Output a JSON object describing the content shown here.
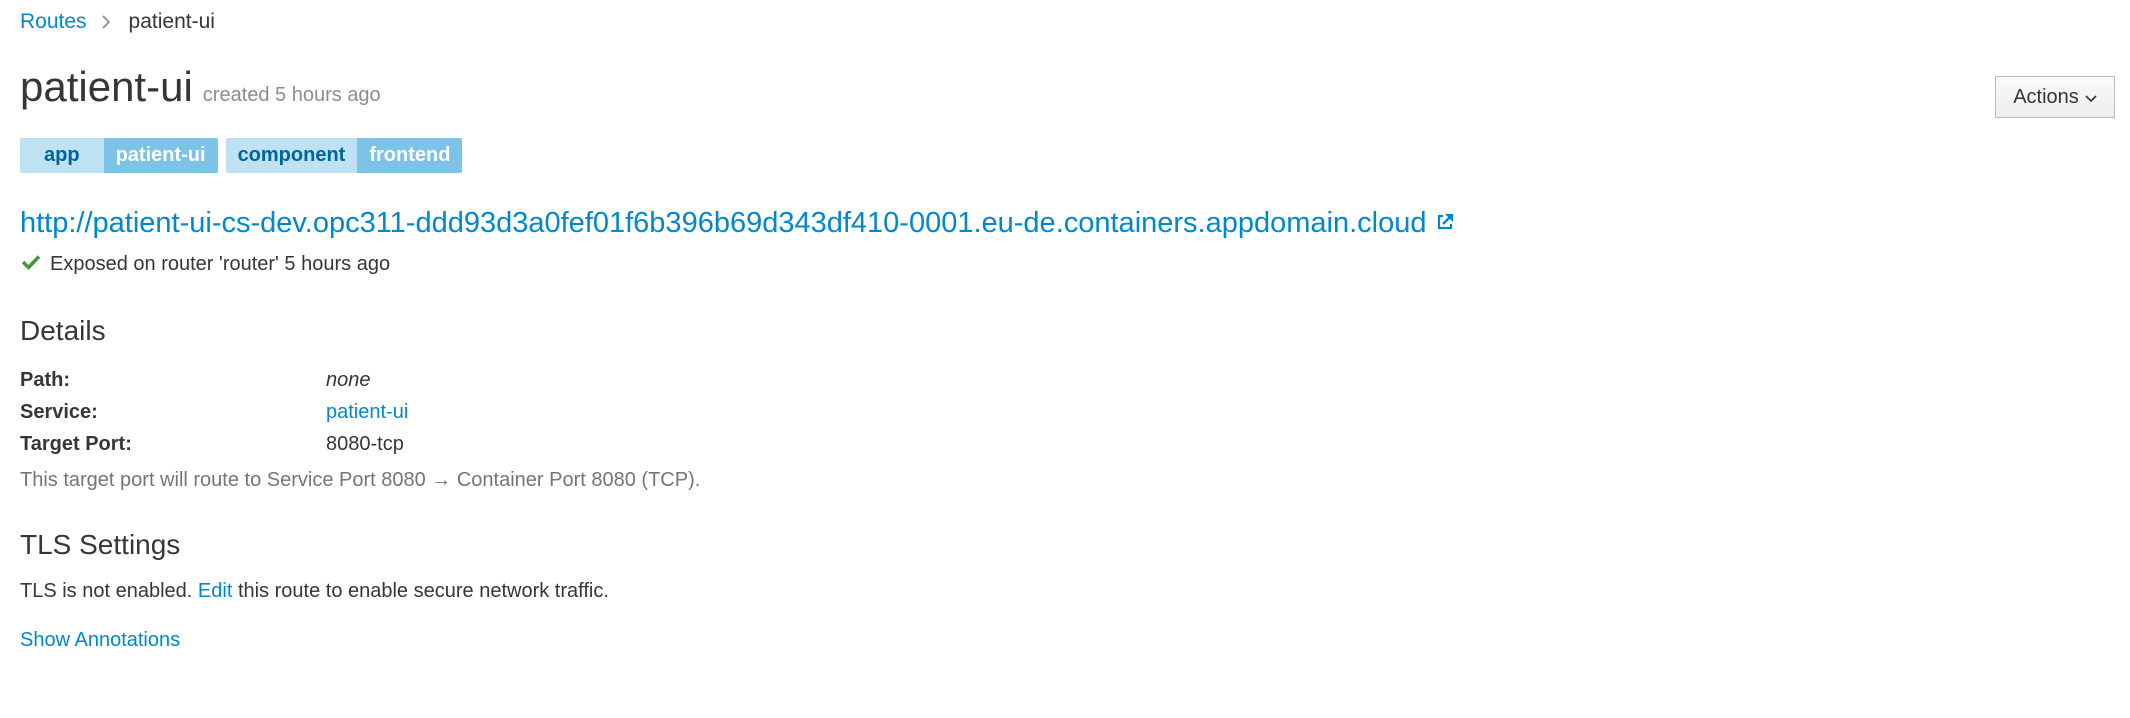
{
  "breadcrumb": {
    "parent": "Routes",
    "current": "patient-ui"
  },
  "header": {
    "title": "patient-ui",
    "created": "created 5 hours ago",
    "actions_label": "Actions"
  },
  "labels": [
    {
      "key": "app",
      "value": "patient-ui"
    },
    {
      "key": "component",
      "value": "frontend"
    }
  ],
  "route": {
    "url": "http://patient-ui-cs-dev.opc311-ddd93d3a0fef01f6b396b69d343df410-0001.eu-de.containers.appdomain.cloud",
    "exposed": "Exposed on router 'router' 5 hours ago"
  },
  "details": {
    "title": "Details",
    "path_label": "Path:",
    "path_value": "none",
    "service_label": "Service:",
    "service_value": "patient-ui",
    "target_port_label": "Target Port:",
    "target_port_value": "8080-tcp",
    "port_note": "This target port will route to Service Port 8080 → Container Port 8080 (TCP)."
  },
  "tls": {
    "title": "TLS Settings",
    "text_before": "TLS is not enabled.",
    "edit_link": "Edit",
    "text_after": "this route to enable secure network traffic."
  },
  "show_annotations": "Show Annotations",
  "icons": {
    "breadcrumb_separator": "chevron-right-icon",
    "actions_caret": "chevron-down-icon",
    "external_link": "external-link-icon",
    "status": "check-icon"
  },
  "colors": {
    "link": "#0088ce",
    "label_key_bg": "#bee1f4",
    "label_value_bg": "#7dc3e8",
    "success": "#3f9c35"
  }
}
